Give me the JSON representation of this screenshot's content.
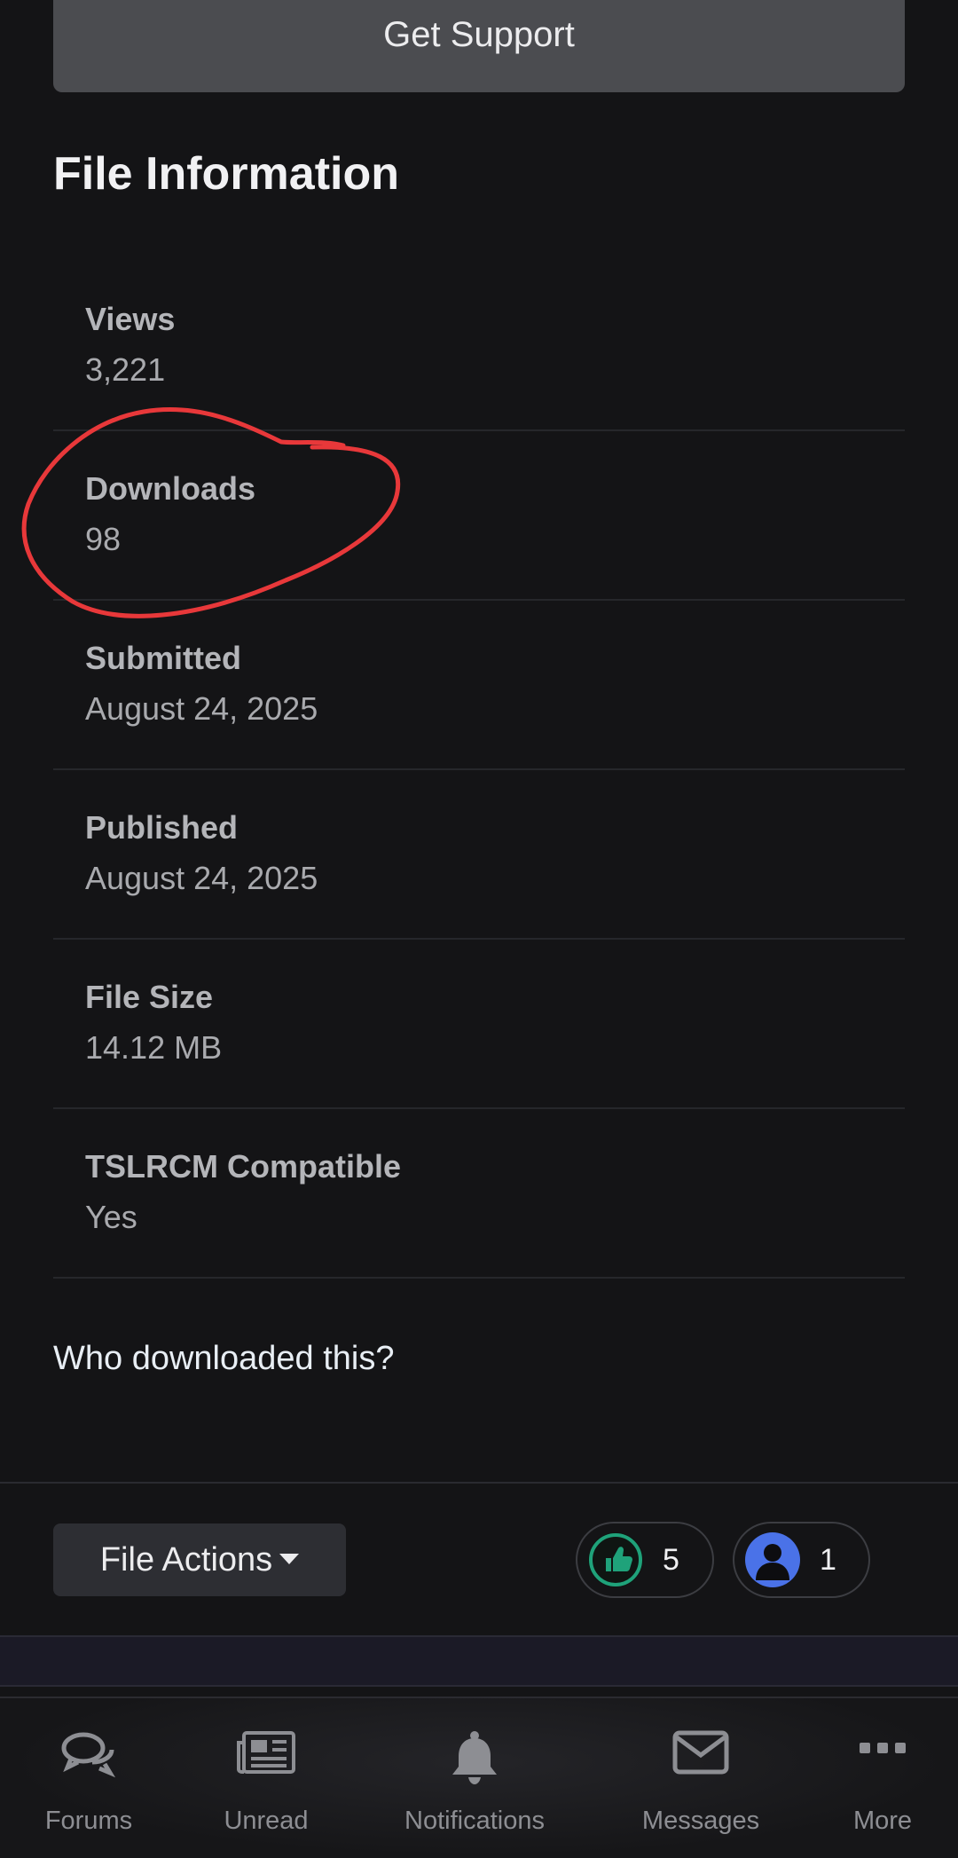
{
  "support": {
    "label": "Get Support"
  },
  "file_info": {
    "title": "File Information",
    "rows": [
      {
        "label": "Views",
        "value": "3,221"
      },
      {
        "label": "Downloads",
        "value": "98"
      },
      {
        "label": "Submitted",
        "value": "August 24, 2025"
      },
      {
        "label": "Published",
        "value": "August 24, 2025"
      },
      {
        "label": "File Size",
        "value": "14.12 MB"
      },
      {
        "label": "TSLRCM Compatible",
        "value": "Yes"
      }
    ]
  },
  "who_downloaded": "Who downloaded this?",
  "actions": {
    "file_actions_label": "File Actions",
    "likes": {
      "icon": "thumbs-up-icon",
      "count": "5",
      "color": "#1fa27a"
    },
    "users": {
      "icon": "user-silhouette-icon",
      "count": "1",
      "color": "#4a72e8"
    }
  },
  "annotation_color": "#e8383a",
  "bottom_nav": {
    "items": [
      {
        "label": "Forums",
        "icon": "chat-bubbles-icon"
      },
      {
        "label": "Unread",
        "icon": "newspaper-icon"
      },
      {
        "label": "Notifications",
        "icon": "bell-icon"
      },
      {
        "label": "Messages",
        "icon": "envelope-icon"
      },
      {
        "label": "More",
        "icon": "ellipsis-icon"
      }
    ]
  }
}
